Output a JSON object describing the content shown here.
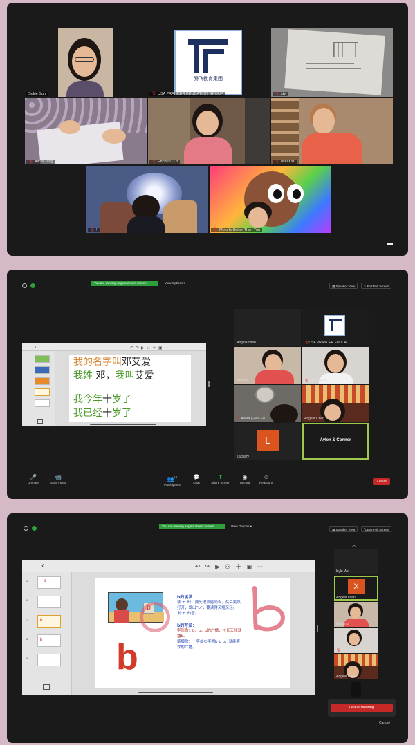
{
  "panel1": {
    "tiles": [
      {
        "name": "Sukie Sun"
      },
      {
        "name": "USA PRANCER EDUCATION GROUP",
        "logo_caption": "腾飞教育集团"
      },
      {
        "name": "styl"
      },
      {
        "name": "Alicia Tang"
      },
      {
        "name": "Enchun Li b"
      },
      {
        "name": "oscar su"
      },
      {
        "name": "!"
      },
      {
        "name": "Mom Is Better Than You"
      }
    ]
  },
  "panel2": {
    "viewing": "You are viewing Angela chen's screen",
    "view_options": "View Options ▾",
    "speaker_view": "Speaker View",
    "exit_full": "Exit Full Screen",
    "slide": {
      "line1_a": "我的名字叫",
      "line1_b": "邓艾爱",
      "line2_a": "我姓",
      "line2_b": "邓，",
      "line2_c": "我叫",
      "line2_d": "艾爱",
      "line3_a": "我今年",
      "line3_b": "十",
      "line3_c": "岁了",
      "line4_a": "我已经",
      "line4_b": "十",
      "line4_c": "岁了"
    },
    "gallery": [
      {
        "name": "Angela chen"
      },
      {
        "name": "USA PRANCER EDUCA..."
      },
      {
        "name": "lech545"
      },
      {
        "name": "Bethel Jiao"
      },
      {
        "name": "Avera (Gao) En"
      },
      {
        "name": "Angela Chen"
      },
      {
        "name": "Zachary",
        "letter": "L"
      },
      {
        "name": "Aylen & Conner"
      }
    ],
    "toolbar": {
      "unmute": "Unmute",
      "start_video": "Start Video",
      "participants": "Participants",
      "participants_count": "13",
      "chat": "Chat",
      "share": "Share Screen",
      "record": "Record",
      "reactions": "Reactions",
      "leave": "Leave"
    }
  },
  "panel3": {
    "viewing": "You are viewing Angela chen's screen",
    "view_options": "View Options ▾",
    "speaker_view": "Speaker View",
    "exit_full": "Exit Full Screen",
    "slide": {
      "title1": "b的读法：",
      "body1": "读“b”时，要先把双唇闭合，然后突然打开，发出“b”，要读得又短又轻。发“b”的音。",
      "title2": "b的写法：",
      "body2a": "字形歌：b，b，b的广播，拉长天线就播b。",
      "body2b": "笔顺歌：一竖加右半圆b b b，就能喜欢的广播。",
      "big_letter": "b",
      "picture_letter": "b",
      "thumb_labels": [
        "6",
        "6",
        "7",
        "8",
        "9"
      ]
    },
    "strip": [
      {
        "name": "Kyle Wu"
      },
      {
        "name": "Angela chen",
        "letter": "X"
      },
      {
        "name": "Tingting"
      },
      {
        "name": "PLAY STOR..."
      },
      {
        "name": "Angela Chen"
      }
    ],
    "leave_meeting": "Leave Meeting",
    "cancel": "Cancel"
  },
  "colors": {
    "active_border": "#9ec94a",
    "leave_red": "#c62828",
    "viewing_green": "#2f9e3c",
    "slide_orange": "#d9893a",
    "slide_green": "#4c9a2a"
  }
}
